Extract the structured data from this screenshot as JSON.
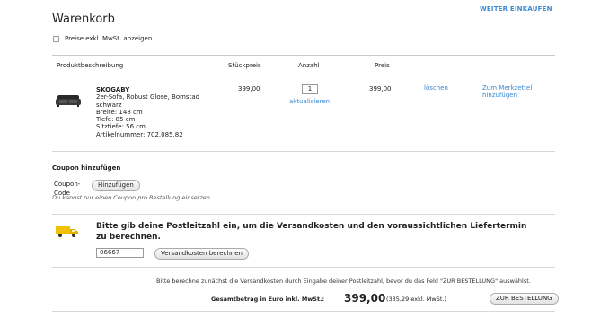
{
  "header": {
    "title": "Warenkorb",
    "continue_shopping": "WEITER EINKAUFEN",
    "vat_checkbox_label": "Preise exkl. MwSt. anzeigen"
  },
  "table": {
    "headers": {
      "description": "Produktbeschreibung",
      "unit_price": "Stückpreis",
      "quantity": "Anzahl",
      "price": "Preis"
    },
    "item": {
      "name": "SKOGABY",
      "line1": "2er-Sofa, Robust Glose, Bomstad",
      "line2": "schwarz",
      "width": "Breite: 148 cm",
      "depth": "Tiefe: 85 cm",
      "seat_depth": "Sitztiefe: 56 cm",
      "article": "Artikelnummer: 702.085.82",
      "unit_price": "399,00",
      "quantity": "1",
      "update": "aktualisieren",
      "price": "399,00",
      "delete": "löschen",
      "wishlist": "Zum Merkzettel hinzufügen"
    }
  },
  "coupon": {
    "heading": "Coupon hinzufügen",
    "label": "Coupon-Code",
    "button": "Hinzufügen",
    "note": "Du kannst nur einen Coupon pro Bestellung einsetzen."
  },
  "shipping": {
    "heading": "Bitte gib deine Postleitzahl ein, um die Versandkosten und den voraussichtlichen Liefertermin zu berechnen.",
    "postcode": "06667",
    "button": "Versandkosten berechnen"
  },
  "footer": {
    "notice": "Bitte berechne zunächst die Versandkosten durch Eingabe deiner Postleitzahl, bevor du das Feld \"ZUR BESTELLUNG\" auswählst.",
    "total_label": "Gesamtbetrag in Euro inkl. MwSt.:",
    "total_value": "399,00",
    "total_excl": "(335,29 exkl. MwSt.)",
    "order_button": "ZUR BESTELLUNG"
  },
  "colors": {
    "link": "#3a8ad6",
    "truck": "#f2c200"
  }
}
